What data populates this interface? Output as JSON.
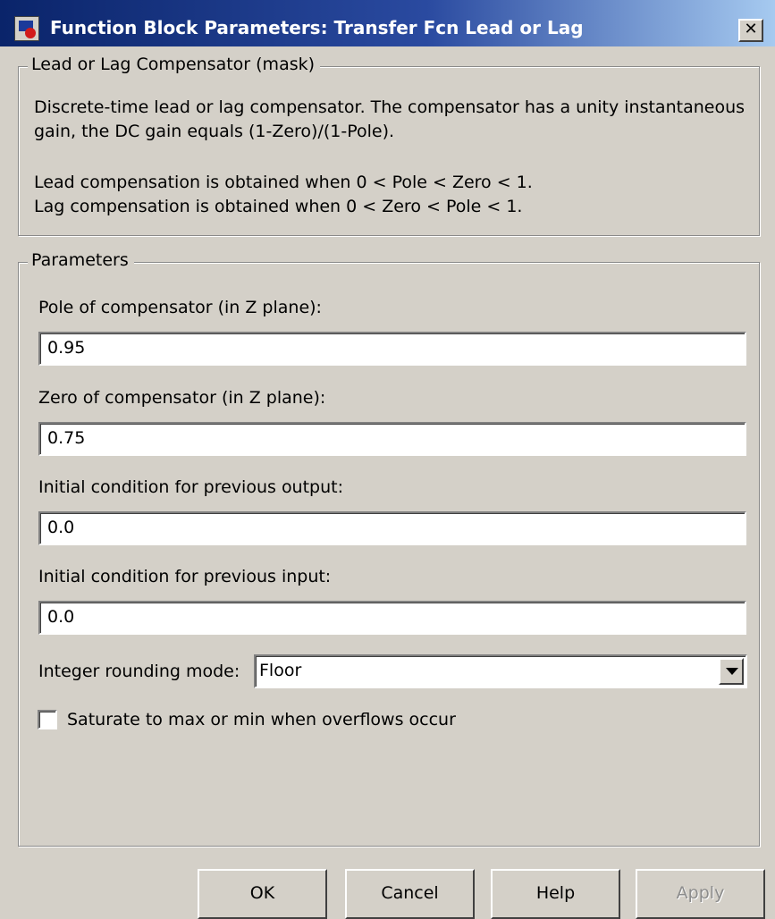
{
  "window": {
    "title": "Function Block Parameters: Transfer Fcn Lead or Lag"
  },
  "description_group": {
    "legend": "Lead or Lag Compensator (mask)",
    "lines": [
      "Discrete-time lead or lag compensator.  The compensator has a unity instantaneous",
      "gain, the DC gain equals (1-Zero)/(1-Pole).",
      "Lead compensation is obtained when 0 < Pole < Zero < 1.",
      "Lag compensation is obtained when 0 < Zero < Pole < 1."
    ]
  },
  "parameters": {
    "legend": "Parameters",
    "pole": {
      "label": "Pole of compensator (in Z plane):",
      "value": "0.95"
    },
    "zero": {
      "label": "Zero of compensator (in Z plane):",
      "value": "0.75"
    },
    "ic_output": {
      "label": "Initial condition for previous output:",
      "value": "0.0"
    },
    "ic_input": {
      "label": "Initial condition for previous input:",
      "value": "0.0"
    },
    "rounding": {
      "label": "Integer rounding mode:",
      "value": "Floor"
    },
    "saturate": {
      "label": "Saturate to max or min when overflows occur",
      "checked": false
    }
  },
  "buttons": {
    "ok": "OK",
    "cancel": "Cancel",
    "help": "Help",
    "apply": "Apply"
  },
  "colors": {
    "titlebar_start": "#0a246a",
    "titlebar_end": "#a6caf0",
    "window_bg": "#d4d0c8"
  },
  "icons": {
    "app": "simulink-block-icon",
    "close": "close-icon",
    "dropdown": "chevron-down-icon"
  }
}
